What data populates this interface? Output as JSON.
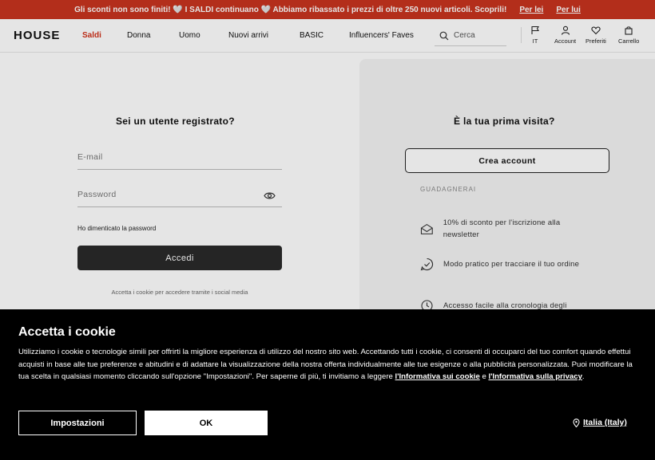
{
  "promo": {
    "message": "Gli sconti non sono finiti! 🤍 I SALDI continuano 🤍 Abbiamo ribassato i prezzi di oltre 250 nuovi articoli. Scoprili!",
    "link_her": "Per lei",
    "link_him": "Per lui"
  },
  "header": {
    "logo": "HOUSE",
    "nav": [
      "Saldi",
      "Donna",
      "Uomo",
      "Nuovi arrivi",
      "BASIC",
      "Influencers' Faves"
    ],
    "search_placeholder": "Cerca",
    "language": "IT",
    "account": "Account",
    "favorites": "Preferiti",
    "cart": "Carrello"
  },
  "login": {
    "heading": "Sei un utente registrato?",
    "email_placeholder": "E-mail",
    "password_placeholder": "Password",
    "forgot": "Ho dimenticato la password",
    "submit": "Accedi",
    "social_note": "Accetta i cookie per accedere tramite i social media"
  },
  "register": {
    "heading": "È la tua prima visita?",
    "create": "Crea account",
    "benefits_title": "GUADAGNERAI",
    "benefits": [
      {
        "icon": "envelope-icon",
        "text": "10% di sconto per l'iscrizione alla newsletter"
      },
      {
        "icon": "check-badge-icon",
        "text": "Modo pratico per tracciare il tuo ordine"
      },
      {
        "icon": "history-icon",
        "text": "Accesso facile alla cronologia degli"
      }
    ]
  },
  "cookie": {
    "title": "Accetta i cookie",
    "text_before": "Utilizziamo i cookie o tecnologie simili per offrirti la migliore esperienza di utilizzo del nostro sito web. Accettando tutti i cookie, ci consenti di occuparci del tuo comfort quando effettui acquisti in base alle tue preferenze e abitudini e di adattare la visualizzazione della nostra offerta individualmente alle tue esigenze o alla pubblicità personalizzata. Puoi modificare la tua scelta in qualsiasi momento cliccando sull'opzione \"Impostazioni\". Per saperne di più, ti invitiamo a leggere ",
    "link_cookie": "l'Informativa sui cookie",
    "and": " e ",
    "link_privacy": "l'Informativa sulla privacy",
    "text_after": ".",
    "settings": "Impostazioni",
    "ok": "OK",
    "region": "Italia (Italy)"
  },
  "colors": {
    "promo": "#c8341f",
    "accent": "#d1321a",
    "cookie_bg": "#000000"
  }
}
